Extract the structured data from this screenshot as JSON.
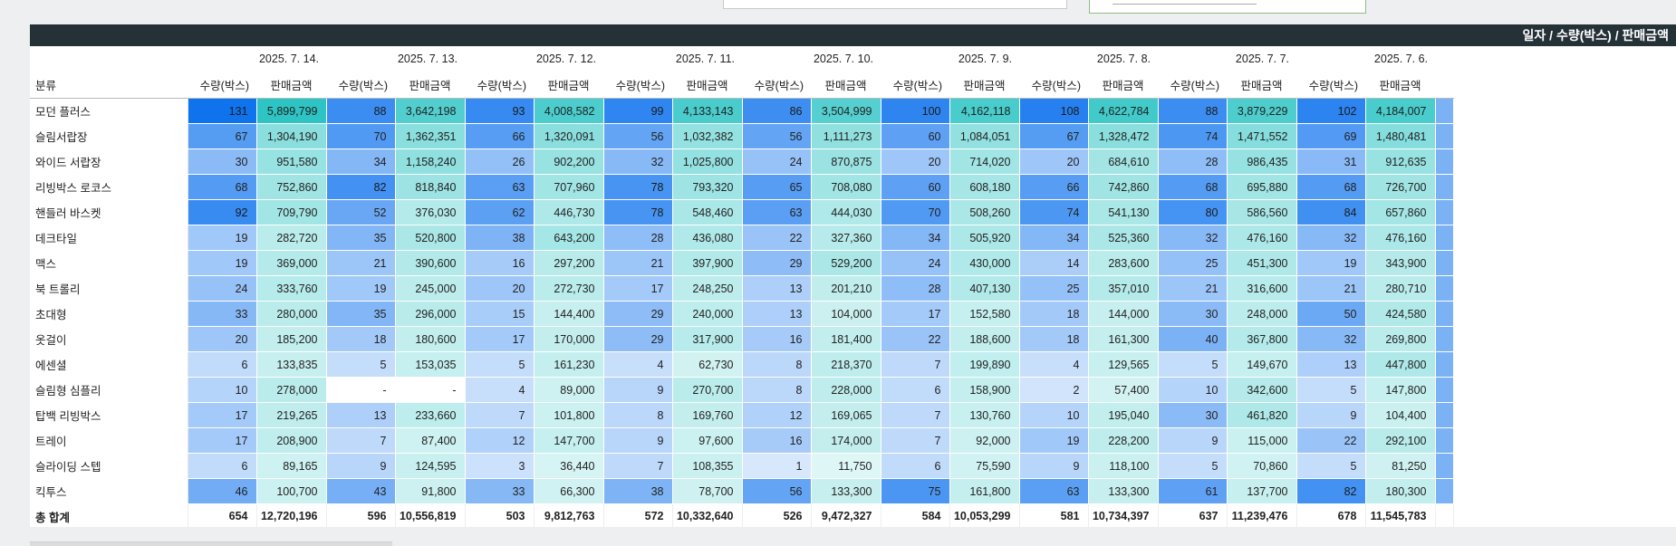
{
  "header": {
    "title": "일자 / 수량(박스) / 판매금액"
  },
  "table": {
    "category_header": "분류",
    "qty_label": "수량(박스)",
    "amt_label": "판매금액",
    "dates": [
      "2025. 7. 14.",
      "2025. 7. 13.",
      "2025. 7. 12.",
      "2025. 7. 11.",
      "2025. 7. 10.",
      "2025. 7. 9.",
      "2025. 7. 8.",
      "2025. 7. 7.",
      "2025. 7. 6."
    ],
    "rows": [
      {
        "name": "모던 플러스",
        "cells": [
          [
            "131",
            "5,899,799"
          ],
          [
            "88",
            "3,642,198"
          ],
          [
            "93",
            "4,008,582"
          ],
          [
            "99",
            "4,133,143"
          ],
          [
            "86",
            "3,504,999"
          ],
          [
            "100",
            "4,162,118"
          ],
          [
            "108",
            "4,622,784"
          ],
          [
            "88",
            "3,879,229"
          ],
          [
            "102",
            "4,184,007"
          ]
        ]
      },
      {
        "name": "슬림서랍장",
        "cells": [
          [
            "67",
            "1,304,190"
          ],
          [
            "70",
            "1,362,351"
          ],
          [
            "66",
            "1,320,091"
          ],
          [
            "56",
            "1,032,382"
          ],
          [
            "56",
            "1,111,273"
          ],
          [
            "60",
            "1,084,051"
          ],
          [
            "67",
            "1,328,472"
          ],
          [
            "74",
            "1,471,552"
          ],
          [
            "69",
            "1,480,481"
          ]
        ]
      },
      {
        "name": "와이드 서랍장",
        "cells": [
          [
            "30",
            "951,580"
          ],
          [
            "34",
            "1,158,240"
          ],
          [
            "26",
            "902,200"
          ],
          [
            "32",
            "1,025,800"
          ],
          [
            "24",
            "870,875"
          ],
          [
            "20",
            "714,020"
          ],
          [
            "20",
            "684,610"
          ],
          [
            "28",
            "986,435"
          ],
          [
            "31",
            "912,635"
          ]
        ]
      },
      {
        "name": "리빙박스 로코스",
        "cells": [
          [
            "68",
            "752,860"
          ],
          [
            "82",
            "818,840"
          ],
          [
            "63",
            "707,960"
          ],
          [
            "78",
            "793,320"
          ],
          [
            "65",
            "708,080"
          ],
          [
            "60",
            "608,180"
          ],
          [
            "66",
            "742,860"
          ],
          [
            "68",
            "695,880"
          ],
          [
            "68",
            "726,700"
          ]
        ]
      },
      {
        "name": "핸들러 바스켓",
        "cells": [
          [
            "92",
            "709,790"
          ],
          [
            "52",
            "376,030"
          ],
          [
            "62",
            "446,730"
          ],
          [
            "78",
            "548,460"
          ],
          [
            "63",
            "444,030"
          ],
          [
            "70",
            "508,260"
          ],
          [
            "74",
            "541,130"
          ],
          [
            "80",
            "586,560"
          ],
          [
            "84",
            "657,860"
          ]
        ]
      },
      {
        "name": "데크타일",
        "cells": [
          [
            "19",
            "282,720"
          ],
          [
            "35",
            "520,800"
          ],
          [
            "38",
            "643,200"
          ],
          [
            "28",
            "436,080"
          ],
          [
            "22",
            "327,360"
          ],
          [
            "34",
            "505,920"
          ],
          [
            "34",
            "525,360"
          ],
          [
            "32",
            "476,160"
          ],
          [
            "32",
            "476,160"
          ]
        ]
      },
      {
        "name": "맥스",
        "cells": [
          [
            "19",
            "369,000"
          ],
          [
            "21",
            "390,600"
          ],
          [
            "16",
            "297,200"
          ],
          [
            "21",
            "397,900"
          ],
          [
            "29",
            "529,200"
          ],
          [
            "24",
            "430,000"
          ],
          [
            "14",
            "283,600"
          ],
          [
            "25",
            "451,300"
          ],
          [
            "19",
            "343,900"
          ]
        ]
      },
      {
        "name": "북 트롤리",
        "cells": [
          [
            "24",
            "333,760"
          ],
          [
            "19",
            "245,000"
          ],
          [
            "20",
            "272,730"
          ],
          [
            "17",
            "248,250"
          ],
          [
            "13",
            "201,210"
          ],
          [
            "28",
            "407,130"
          ],
          [
            "25",
            "357,010"
          ],
          [
            "21",
            "316,600"
          ],
          [
            "21",
            "280,710"
          ]
        ]
      },
      {
        "name": "초대형",
        "cells": [
          [
            "33",
            "280,000"
          ],
          [
            "35",
            "296,000"
          ],
          [
            "15",
            "144,400"
          ],
          [
            "29",
            "240,000"
          ],
          [
            "13",
            "104,000"
          ],
          [
            "17",
            "152,580"
          ],
          [
            "18",
            "144,000"
          ],
          [
            "30",
            "248,000"
          ],
          [
            "50",
            "424,580"
          ]
        ]
      },
      {
        "name": "옷걸이",
        "cells": [
          [
            "20",
            "185,200"
          ],
          [
            "18",
            "180,600"
          ],
          [
            "17",
            "170,000"
          ],
          [
            "29",
            "317,900"
          ],
          [
            "16",
            "181,400"
          ],
          [
            "22",
            "188,600"
          ],
          [
            "18",
            "161,300"
          ],
          [
            "40",
            "367,800"
          ],
          [
            "32",
            "269,800"
          ]
        ]
      },
      {
        "name": "에센셜",
        "cells": [
          [
            "6",
            "133,835"
          ],
          [
            "5",
            "153,035"
          ],
          [
            "5",
            "161,230"
          ],
          [
            "4",
            "62,730"
          ],
          [
            "8",
            "218,370"
          ],
          [
            "7",
            "199,890"
          ],
          [
            "4",
            "129,565"
          ],
          [
            "5",
            "149,670"
          ],
          [
            "13",
            "447,800"
          ]
        ]
      },
      {
        "name": "슬림형 심플리",
        "cells": [
          [
            "10",
            "278,000"
          ],
          [
            "-",
            "-"
          ],
          [
            "4",
            "89,000"
          ],
          [
            "9",
            "270,700"
          ],
          [
            "8",
            "228,000"
          ],
          [
            "6",
            "158,900"
          ],
          [
            "2",
            "57,400"
          ],
          [
            "10",
            "342,600"
          ],
          [
            "5",
            "147,800"
          ]
        ]
      },
      {
        "name": "탑백 리빙박스",
        "cells": [
          [
            "17",
            "219,265"
          ],
          [
            "13",
            "233,660"
          ],
          [
            "7",
            "101,800"
          ],
          [
            "8",
            "169,760"
          ],
          [
            "12",
            "169,065"
          ],
          [
            "7",
            "130,760"
          ],
          [
            "10",
            "195,040"
          ],
          [
            "30",
            "461,820"
          ],
          [
            "9",
            "104,400"
          ]
        ]
      },
      {
        "name": "트레이",
        "cells": [
          [
            "17",
            "208,900"
          ],
          [
            "7",
            "87,400"
          ],
          [
            "12",
            "147,700"
          ],
          [
            "9",
            "97,600"
          ],
          [
            "16",
            "174,000"
          ],
          [
            "7",
            "92,000"
          ],
          [
            "19",
            "228,200"
          ],
          [
            "9",
            "115,000"
          ],
          [
            "22",
            "292,100"
          ]
        ]
      },
      {
        "name": "슬라이딩 스텝",
        "cells": [
          [
            "6",
            "89,165"
          ],
          [
            "9",
            "124,595"
          ],
          [
            "3",
            "36,440"
          ],
          [
            "7",
            "108,355"
          ],
          [
            "1",
            "11,750"
          ],
          [
            "6",
            "75,590"
          ],
          [
            "9",
            "118,100"
          ],
          [
            "5",
            "70,860"
          ],
          [
            "5",
            "81,250"
          ]
        ]
      },
      {
        "name": "킥투스",
        "cells": [
          [
            "46",
            "100,700"
          ],
          [
            "43",
            "91,800"
          ],
          [
            "33",
            "66,300"
          ],
          [
            "38",
            "78,700"
          ],
          [
            "56",
            "133,300"
          ],
          [
            "75",
            "161,800"
          ],
          [
            "63",
            "133,300"
          ],
          [
            "61",
            "137,700"
          ],
          [
            "82",
            "180,300"
          ]
        ]
      }
    ],
    "total": {
      "name": "총 합계",
      "cells": [
        [
          "654",
          "12,720,196"
        ],
        [
          "596",
          "10,556,819"
        ],
        [
          "503",
          "9,812,763"
        ],
        [
          "572",
          "10,332,640"
        ],
        [
          "526",
          "9,472,327"
        ],
        [
          "584",
          "10,053,299"
        ],
        [
          "581",
          "10,734,397"
        ],
        [
          "637",
          "11,239,476"
        ],
        [
          "678",
          "11,545,783"
        ]
      ]
    }
  },
  "colors": {
    "qty_high": "#0f73ee",
    "qty_low": "#ffffff",
    "amt_high": "#2ec4c4",
    "amt_low": "#ffffff",
    "title_bar": "#243137"
  }
}
